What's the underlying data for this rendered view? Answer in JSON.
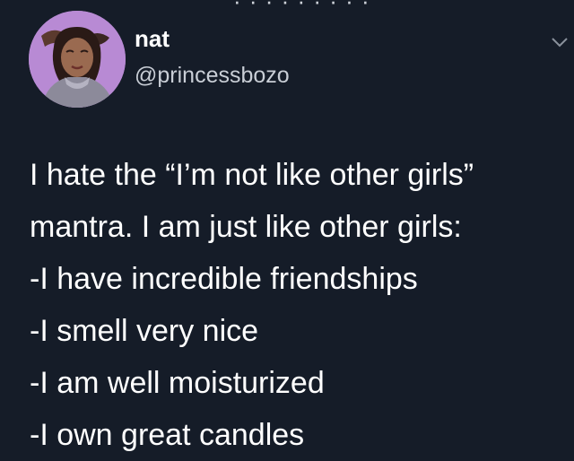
{
  "tweet": {
    "author": {
      "display_name": "nat",
      "handle": "@princessbozo"
    },
    "lines": [
      "I hate the “I’m not like other girls”",
      "mantra. I am just like other girls:",
      "-I have incredible friendships",
      "-I smell very nice",
      "-I am well moisturized",
      "-I own great candles"
    ]
  },
  "icons": {
    "avatar": "avatar-photo",
    "menu": "chevron-down-icon"
  },
  "colors": {
    "background": "#151c28",
    "text": "#ffffff",
    "handle_text": "#c9ced6",
    "avatar_bg": "#b98ad6"
  }
}
